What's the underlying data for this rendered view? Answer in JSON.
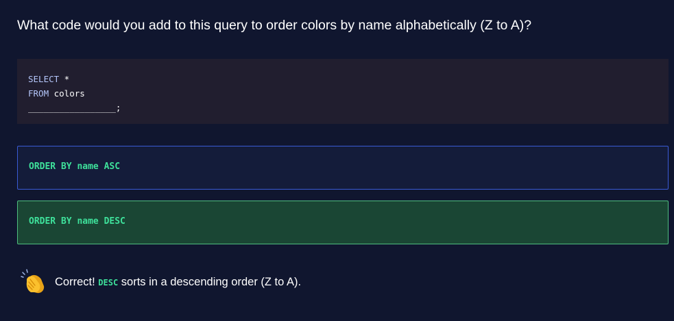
{
  "question": {
    "text": "What code would you add to this query to order colors by name alphabetically (Z to A)?"
  },
  "code": {
    "line1_keyword": "SELECT",
    "line1_rest": " *",
    "line2_keyword": "FROM",
    "line2_rest": " colors",
    "line3_blank": "_________________;"
  },
  "options": [
    {
      "label": "ORDER BY name ASC",
      "state": "unselected"
    },
    {
      "label": "ORDER BY name DESC",
      "state": "correct"
    }
  ],
  "feedback": {
    "icon": "clapping-hands-icon",
    "prefix": "Correct!",
    "code": "DESC",
    "suffix": "sorts in a descending order (Z to A)."
  },
  "colors": {
    "background": "#10162f",
    "code_background": "#211e2f",
    "option_border": "#3a5bd6",
    "correct_background": "#1a4634",
    "correct_border": "#4fbf7f",
    "accent_green": "#3ee19b"
  }
}
